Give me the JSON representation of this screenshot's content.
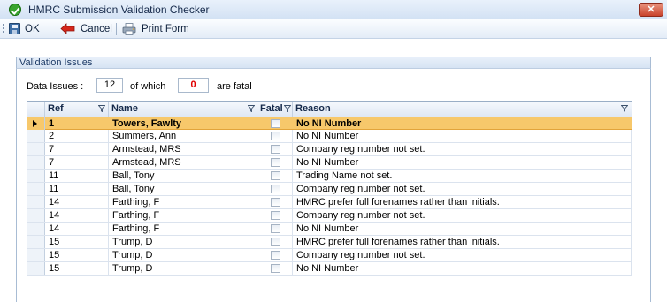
{
  "window": {
    "title": "HMRC Submission Validation Checker"
  },
  "toolbar": {
    "ok_label": "OK",
    "cancel_label": "Cancel",
    "print_label": "Print Form"
  },
  "group": {
    "title": "Validation Issues",
    "data_issues_label": "Data Issues :",
    "issues_count": "12",
    "of_which_label": "of which",
    "fatal_count": "0",
    "are_fatal_label": "are fatal"
  },
  "grid": {
    "columns": [
      "Ref",
      "Name",
      "Fatal",
      "Reason"
    ],
    "rows": [
      {
        "ref": "1",
        "name": "Towers, Fawlty",
        "fatal": false,
        "reason": "No NI Number",
        "selected": true
      },
      {
        "ref": "2",
        "name": "Summers, Ann",
        "fatal": false,
        "reason": "No NI Number"
      },
      {
        "ref": "7",
        "name": "Armstead, MRS",
        "fatal": false,
        "reason": "Company reg number not set."
      },
      {
        "ref": "7",
        "name": "Armstead, MRS",
        "fatal": false,
        "reason": "No NI Number"
      },
      {
        "ref": "11",
        "name": "Ball, Tony",
        "fatal": false,
        "reason": "Trading Name not set."
      },
      {
        "ref": "11",
        "name": "Ball, Tony",
        "fatal": false,
        "reason": "Company reg number not set."
      },
      {
        "ref": "14",
        "name": "Farthing, F",
        "fatal": false,
        "reason": "HMRC prefer full forenames rather than initials."
      },
      {
        "ref": "14",
        "name": "Farthing, F",
        "fatal": false,
        "reason": "Company reg number not set."
      },
      {
        "ref": "14",
        "name": "Farthing, F",
        "fatal": false,
        "reason": "No NI Number"
      },
      {
        "ref": "15",
        "name": "Trump, D",
        "fatal": false,
        "reason": "HMRC prefer full forenames rather than initials."
      },
      {
        "ref": "15",
        "name": "Trump, D",
        "fatal": false,
        "reason": "Company reg number not set."
      },
      {
        "ref": "15",
        "name": "Trump, D",
        "fatal": false,
        "reason": "No NI Number"
      }
    ]
  },
  "colors": {
    "selected_row": "#f7c86b",
    "fatal_count_text": "#e00000",
    "close_button": "#c9432c"
  },
  "icons": {
    "app": "green-check-icon",
    "ok": "save-disk-icon",
    "cancel": "red-back-arrow-icon",
    "print": "print-form-icon",
    "filter": "filter-funnel-icon",
    "close": "close-icon",
    "row_pointer": "row-pointer-icon"
  }
}
